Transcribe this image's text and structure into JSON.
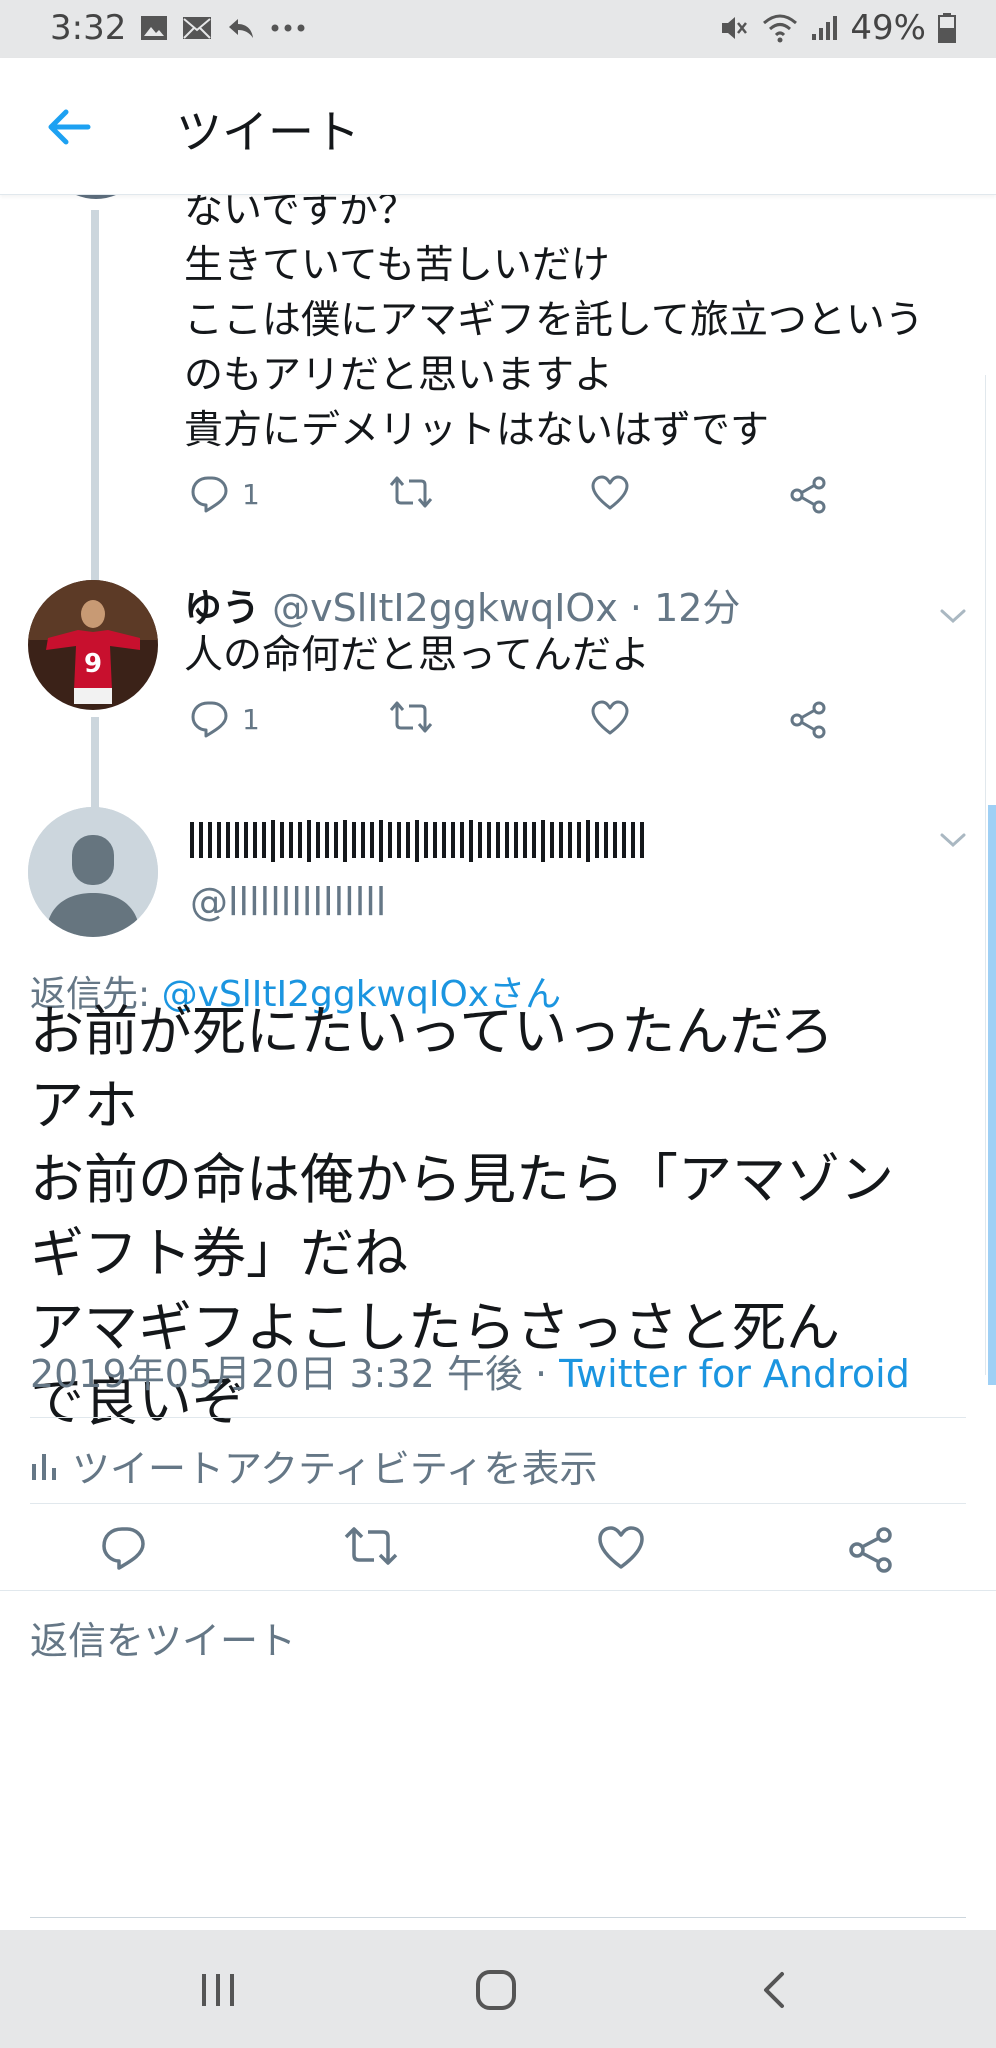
{
  "status_bar": {
    "time": "3:32",
    "battery": "49%",
    "left_icons": [
      "image-icon",
      "mail-icon",
      "reply-arrow-icon",
      "more-dots-icon"
    ],
    "right_icons": [
      "mute-icon",
      "wifi-icon",
      "signal-icon",
      "battery-icon"
    ]
  },
  "header": {
    "title": "ツイート"
  },
  "tweets": [
    {
      "text": "ないですか？\n生きていても苦しいだけ\nここは僕にアマギフを託して旅立つという\nのもアリだと思いますよ\n貴方にデメリットはないはずです",
      "reply_count": "1"
    },
    {
      "name": "ゆう",
      "handle": "@vSlItI2ggkwqIOx",
      "time": "· 12分",
      "text": "人の命何だと思ってんだよ",
      "reply_count": "1",
      "avatar_jersey_number": "9"
    }
  ],
  "main_tweet": {
    "handle": "@lllllllllllllll",
    "reply_prefix": "返信先: ",
    "reply_to": "@vSlItI2ggkwqIOxさん",
    "text": "お前が死にたいっていったんだろ\nアホ\nお前の命は俺から見たら「アマゾン\nギフト券」だね\nアマギフよこしたらさっさと死ん\nで良いぞ",
    "timestamp": "2019年05月20日 3:32 午後 · ",
    "source": "Twitter for Android",
    "activity_label": "ツイートアクティビティを表示"
  },
  "compose": {
    "placeholder": "返信をツイート"
  },
  "colors": {
    "accent": "#1da1f2",
    "link": "#1b95e0",
    "muted": "#657786",
    "thread_line": "#ccd6dd"
  }
}
